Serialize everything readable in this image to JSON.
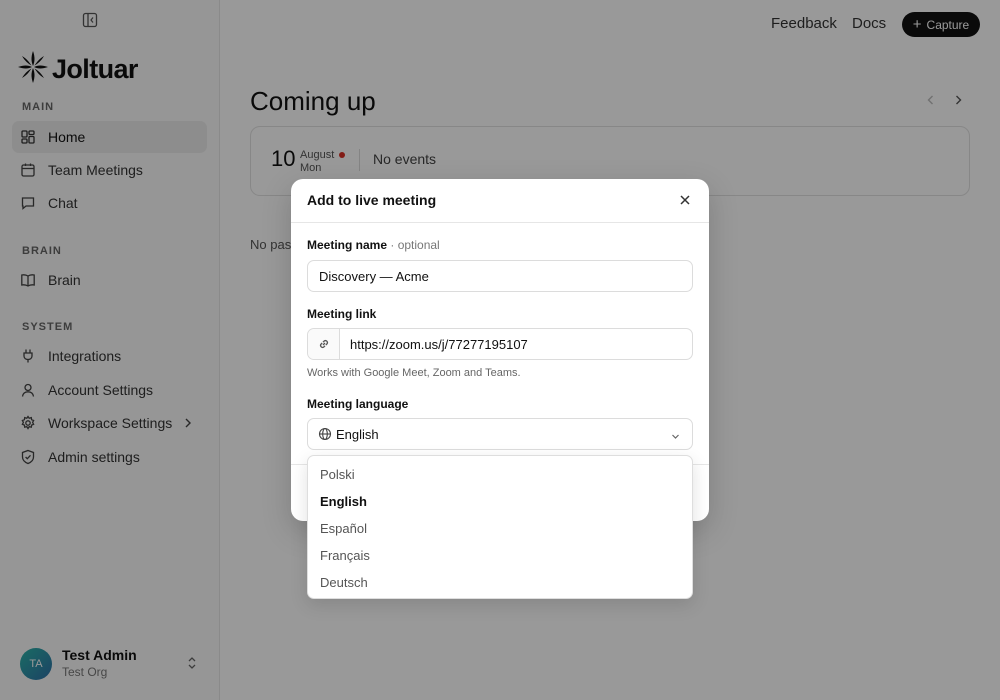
{
  "app": {
    "brand": "Joltuar"
  },
  "topbar": {
    "feedback_label": "Feedback",
    "docs_label": "Docs",
    "capture_label": "Capture"
  },
  "sidebar": {
    "sections": [
      {
        "label": "MAIN"
      },
      {
        "label": "BRAIN"
      },
      {
        "label": "SYSTEM"
      }
    ],
    "items": [
      {
        "label": "Home",
        "icon": "grid-icon",
        "active": true
      },
      {
        "label": "Team Meetings",
        "icon": "calendar-icon"
      },
      {
        "label": "Chat",
        "icon": "message-icon"
      },
      {
        "label": "Brain",
        "icon": "book-icon"
      },
      {
        "label": "Integrations",
        "icon": "plug-icon"
      },
      {
        "label": "Account Settings",
        "icon": "user-icon"
      },
      {
        "label": "Workspace Settings",
        "icon": "gear-icon"
      },
      {
        "label": "Admin settings",
        "icon": "shield-icon"
      }
    ],
    "user": {
      "initials": "TA",
      "name": "Test Admin",
      "org": "Test Org"
    }
  },
  "main": {
    "title": "Coming up",
    "event": {
      "day": "10",
      "month": "August",
      "weekday": "Mon",
      "empty_text": "No events"
    },
    "no_past_text": "No pas"
  },
  "modal": {
    "title": "Add to live meeting",
    "name_label": "Meeting name",
    "name_optional": "· optional",
    "name_value": "Discovery — Acme",
    "link_label": "Meeting link",
    "link_value": "https://zoom.us/j/77277195107",
    "link_hint": "Works with Google Meet, Zoom and Teams.",
    "language_label": "Meeting language",
    "language_value": "English",
    "language_options": [
      "Polski",
      "English",
      "Español",
      "Français",
      "Deutsch"
    ],
    "selected_option": "English"
  },
  "colors": {
    "accent": "#111111",
    "overlay": "rgba(0,0,0,0.40)",
    "status_dot": "#d93025"
  }
}
